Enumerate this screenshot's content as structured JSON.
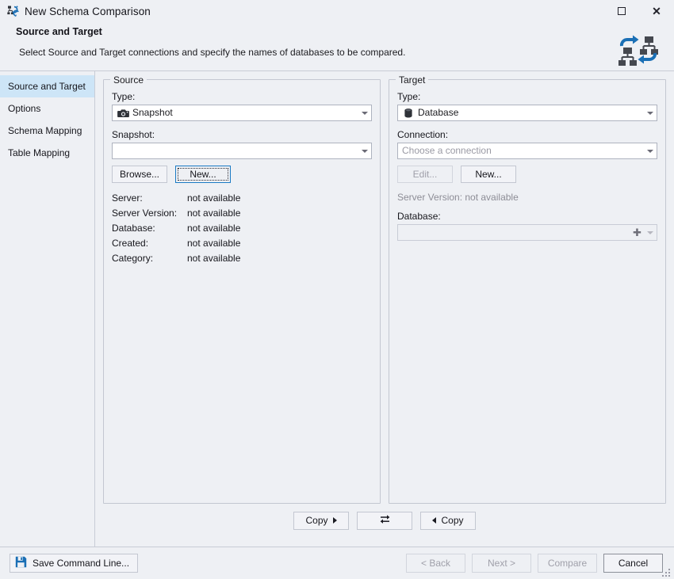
{
  "window": {
    "title": "New Schema Comparison",
    "icon": "schema-comparison-icon",
    "maximize_label": "Maximize",
    "close_label": "Close"
  },
  "header": {
    "title": "Source and Target",
    "subtitle": "Select Source and Target connections and specify the names of databases to be compared.",
    "icon": "schema-compare-banner-icon"
  },
  "sidebar": {
    "items": [
      {
        "label": "Source and Target",
        "selected": true
      },
      {
        "label": "Options",
        "selected": false
      },
      {
        "label": "Schema Mapping",
        "selected": false
      },
      {
        "label": "Table Mapping",
        "selected": false
      }
    ]
  },
  "source": {
    "legend": "Source",
    "type_label": "Type:",
    "type_value": "Snapshot",
    "type_icon": "camera-icon",
    "snapshot_label": "Snapshot:",
    "snapshot_value": "",
    "browse_label": "Browse...",
    "new_label": "New...",
    "info": [
      {
        "key": "Server:",
        "value": "not available"
      },
      {
        "key": "Server Version:",
        "value": "not available"
      },
      {
        "key": "Database:",
        "value": "not available"
      },
      {
        "key": "Created:",
        "value": "not available"
      },
      {
        "key": "Category:",
        "value": "not available"
      }
    ]
  },
  "target": {
    "legend": "Target",
    "type_label": "Type:",
    "type_value": "Database",
    "type_icon": "database-icon",
    "connection_label": "Connection:",
    "connection_placeholder": "Choose a connection",
    "edit_label": "Edit...",
    "new_label": "New...",
    "server_version_text": "Server Version: not available",
    "database_label": "Database:",
    "database_value": ""
  },
  "copybar": {
    "copy_right_label": "Copy",
    "swap_icon": "swap-arrows-icon",
    "copy_left_label": "Copy"
  },
  "footer": {
    "save_command_line_label": "Save Command Line...",
    "save_icon": "floppy-save-icon",
    "back_label": "< Back",
    "next_label": "Next >",
    "compare_label": "Compare",
    "cancel_label": "Cancel"
  },
  "colors": {
    "accent_blue": "#1a6fb5",
    "selection_blue": "#cde5f7",
    "window_bg": "#eef0f4",
    "border": "#c3c7d1",
    "disabled_text": "#a0a0aa"
  }
}
